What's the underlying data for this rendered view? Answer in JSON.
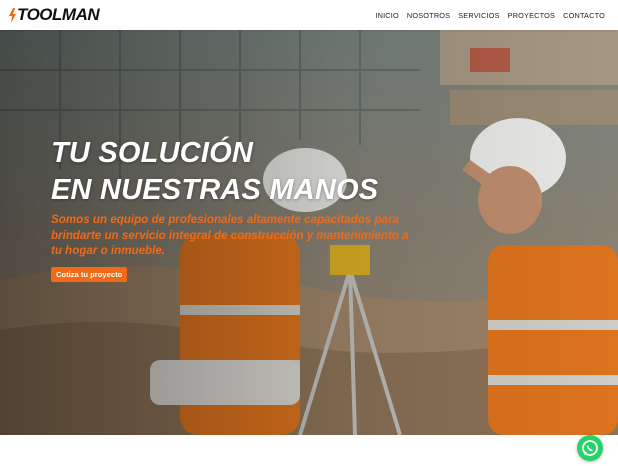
{
  "brand": {
    "logo_text": "TOOLMAN",
    "accent_color": "#f26a16"
  },
  "nav": {
    "items": [
      {
        "label": "INICIO"
      },
      {
        "label": "NOSOTROS"
      },
      {
        "label": "SERVICIOS"
      },
      {
        "label": "PROYECTOS"
      },
      {
        "label": "CONTACTO"
      }
    ]
  },
  "hero": {
    "title_line1": "TU SOLUCIÓN",
    "title_line2": "EN NUESTRAS MANOS",
    "description": "Somos un equipo de profesionales altamente capacitados para brindarte un servicio integral de construcción y mantenimiento a tu hogar o inmueble.",
    "cta_label": "Cotiza tu proyecto",
    "background_image": "construction-workers-photo"
  },
  "floating": {
    "whatsapp_icon": "whatsapp-icon",
    "whatsapp_color": "#25d366"
  }
}
